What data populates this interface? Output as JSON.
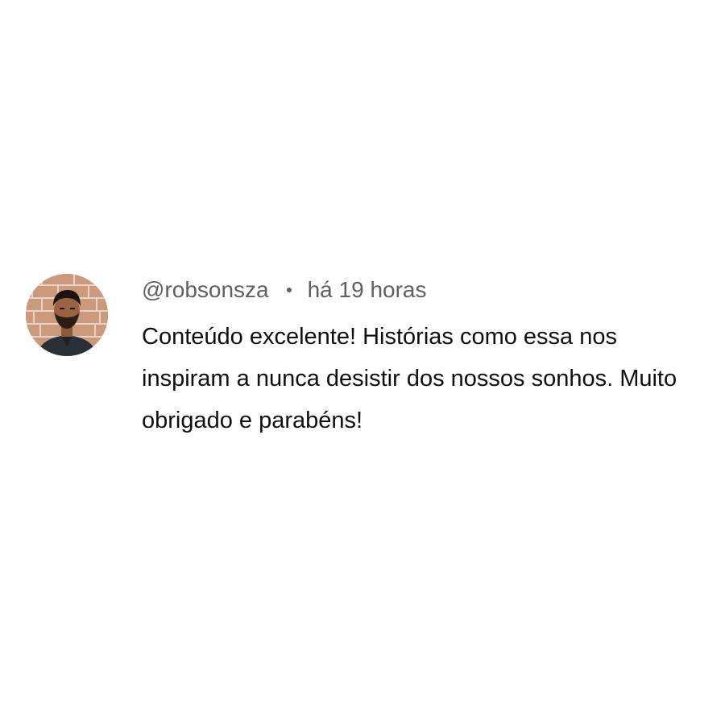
{
  "comment": {
    "author_handle": "@robsonsza",
    "separator": "•",
    "timestamp": "há 19 horas",
    "text": "Conteúdo excelente! Histórias como essa nos inspiram a nunca desistir dos nossos sonhos. Muito obrigado e parabéns!",
    "avatar_icon": "user-avatar-photo"
  },
  "colors": {
    "meta_text": "#606060",
    "body_text": "#0f0f0f",
    "background": "#ffffff"
  }
}
